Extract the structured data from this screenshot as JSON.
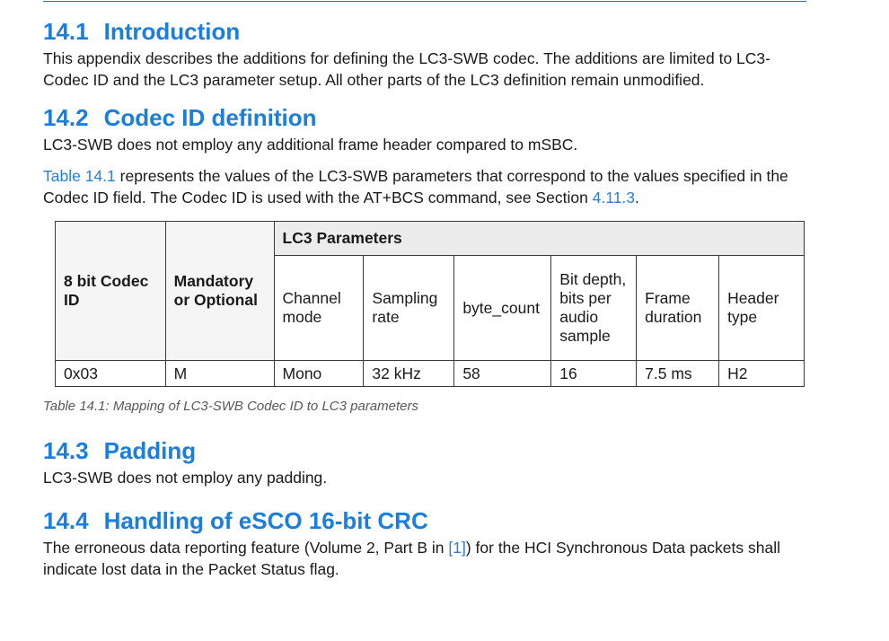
{
  "sections": {
    "intro": {
      "number": "14.1",
      "title": "Introduction",
      "body": "This appendix describes the additions for defining the LC3-SWB codec. The additions are limited to LC3-Codec ID and the LC3 parameter setup. All other parts of the LC3 definition remain unmodified."
    },
    "codec_id": {
      "number": "14.2",
      "title": "Codec ID definition",
      "body1": "LC3-SWB does not employ any additional frame header compared to mSBC.",
      "body2_link": "Table 14.1",
      "body2_mid": " represents the values of the LC3-SWB parameters that correspond to the values specified in the Codec ID field. The Codec ID is used with the AT+BCS command, see Section ",
      "body2_link2": "4.11.3",
      "body2_end": "."
    },
    "padding": {
      "number": "14.3",
      "title": "Padding",
      "body": "LC3-SWB does not employ any padding."
    },
    "crc": {
      "number": "14.4",
      "title": "Handling of eSCO 16-bit CRC",
      "body_start": "The erroneous data reporting feature (Volume 2, Part B in ",
      "body_link": "[1]",
      "body_end": ") for the HCI Synchronous Data packets shall indicate lost data in the Packet Status flag."
    }
  },
  "table": {
    "col_codec_id": "8 bit Codec ID",
    "col_mandatory": "Mandatory or Optional",
    "group_header": "LC3 Parameters",
    "sub_headers": [
      "Channel mode",
      "Sampling rate",
      "byte_count",
      "Bit depth, bits per audio sample",
      "Frame duration",
      "Header type"
    ],
    "rows": [
      [
        "0x03",
        "M",
        "Mono",
        "32 kHz",
        "58",
        "16",
        "7.5 ms",
        "H2"
      ]
    ],
    "caption": "Table 14.1: Mapping of LC3-SWB Codec ID to LC3 parameters"
  }
}
